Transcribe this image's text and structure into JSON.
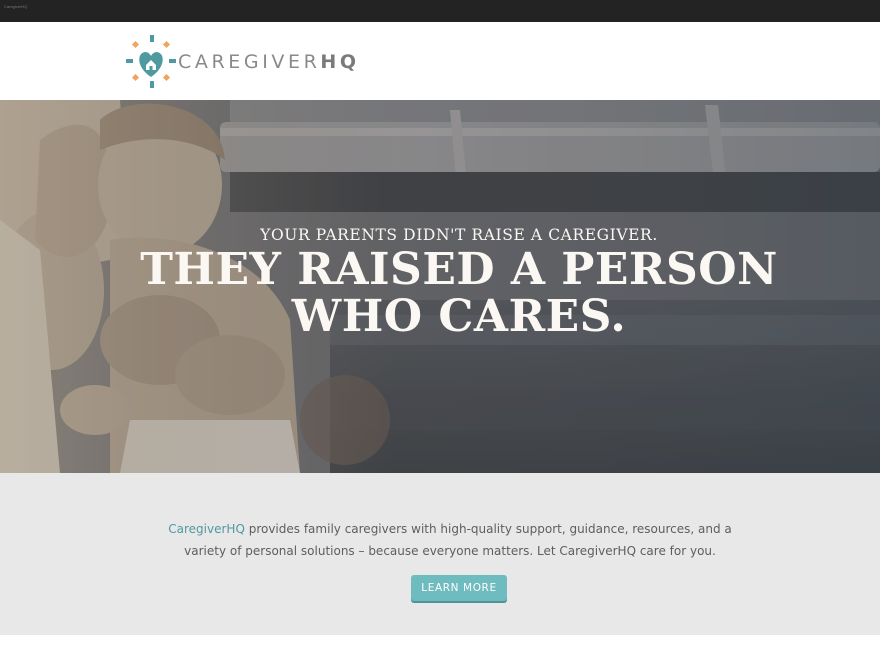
{
  "browser": {
    "tab_label": "CaregiverHQ"
  },
  "header": {
    "logo": {
      "name": "CAREGIVER",
      "suffix": "HQ"
    }
  },
  "hero": {
    "subtitle": "Your parents didn't raise a caregiver.",
    "title_line1": "They raised a person",
    "title_line2": "who cares."
  },
  "intro": {
    "brand": "CaregiverHQ",
    "body": " provides family caregivers with high-quality support, guidance, resources, and a variety of personal solutions – because everyone matters. Let CaregiverHQ care for you.",
    "button_label": "Learn more"
  },
  "colors": {
    "accent_teal": "#4f9aa0",
    "accent_orange": "#f0a45e",
    "button": "#6fbcc0",
    "intro_bg": "#e8e8e8"
  },
  "icons": [
    "caregiver-heart-house-logo-icon"
  ]
}
